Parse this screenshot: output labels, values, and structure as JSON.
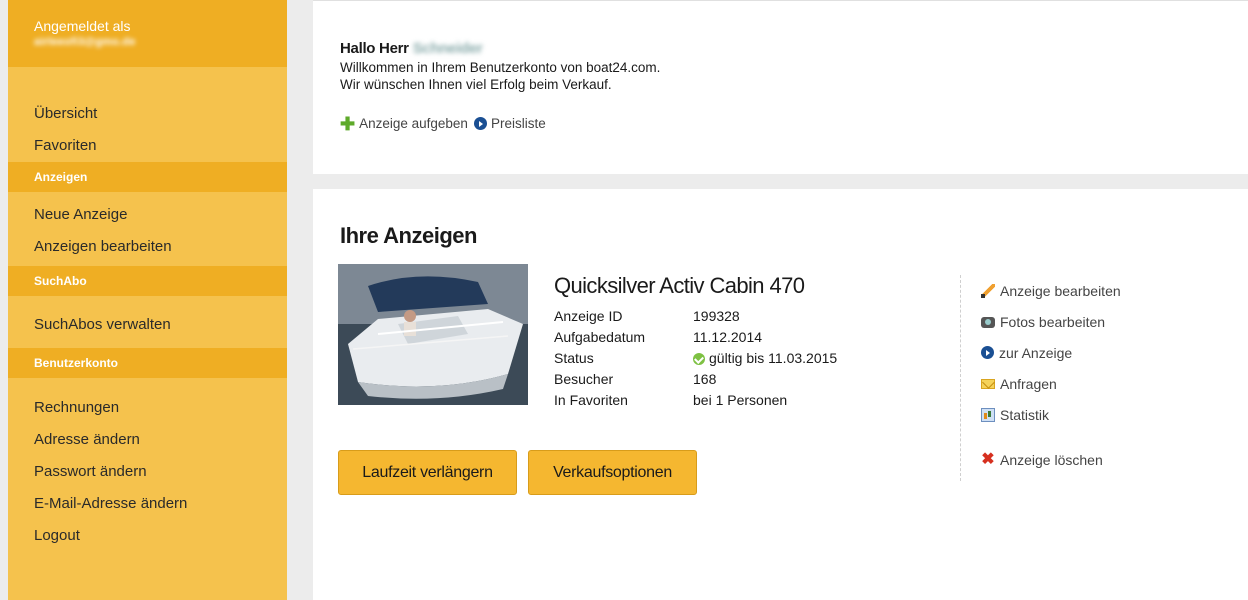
{
  "sidebar": {
    "logged_in_label": "Angemeldet als",
    "email": "airleeofi3@gmo.de",
    "items_main": [
      {
        "label": "Übersicht"
      },
      {
        "label": "Favoriten"
      }
    ],
    "section_ads": "Anzeigen",
    "items_ads": [
      {
        "label": "Neue Anzeige"
      },
      {
        "label": "Anzeigen bearbeiten"
      }
    ],
    "section_search": "SuchAbo",
    "items_search": [
      {
        "label": "SuchAbos verwalten"
      }
    ],
    "section_account": "Benutzerkonto",
    "items_account": [
      {
        "label": "Rechnungen"
      },
      {
        "label": "Adresse ändern"
      },
      {
        "label": "Passwort ändern"
      },
      {
        "label": "E-Mail-Adresse ändern"
      },
      {
        "label": "Logout"
      }
    ]
  },
  "welcome": {
    "greeting": "Hallo Herr",
    "name": "Schneider",
    "line1": "Willkommen in Ihrem Benutzerkonto von boat24.com.",
    "line2": "Wir wünschen Ihnen viel Erfolg beim Verkauf.",
    "link_new_ad": "Anzeige aufgeben",
    "link_pricelist": "Preisliste"
  },
  "ads": {
    "title": "Ihre Anzeigen",
    "listing": {
      "title": "Quicksilver Activ Cabin 470",
      "details": [
        {
          "label": "Anzeige ID",
          "value": "199328"
        },
        {
          "label": "Aufgabedatum",
          "value": "11.12.2014"
        },
        {
          "label": "Status",
          "value": "gültig bis 11.03.2015"
        },
        {
          "label": "Besucher",
          "value": "168"
        },
        {
          "label": "In Favoriten",
          "value": "bei 1 Personen"
        }
      ],
      "button_extend": "Laufzeit verlängern",
      "button_sale_options": "Verkaufsoptionen",
      "actions": {
        "edit": "Anzeige bearbeiten",
        "photos": "Fotos bearbeiten",
        "view": "zur Anzeige",
        "requests": "Anfragen",
        "stats": "Statistik",
        "delete": "Anzeige löschen"
      }
    }
  },
  "colors": {
    "sidebar_bg": "#f5c24d",
    "sidebar_header_bg": "#efae23",
    "button_bg": "#f5b730",
    "page_bg": "#ececec"
  }
}
